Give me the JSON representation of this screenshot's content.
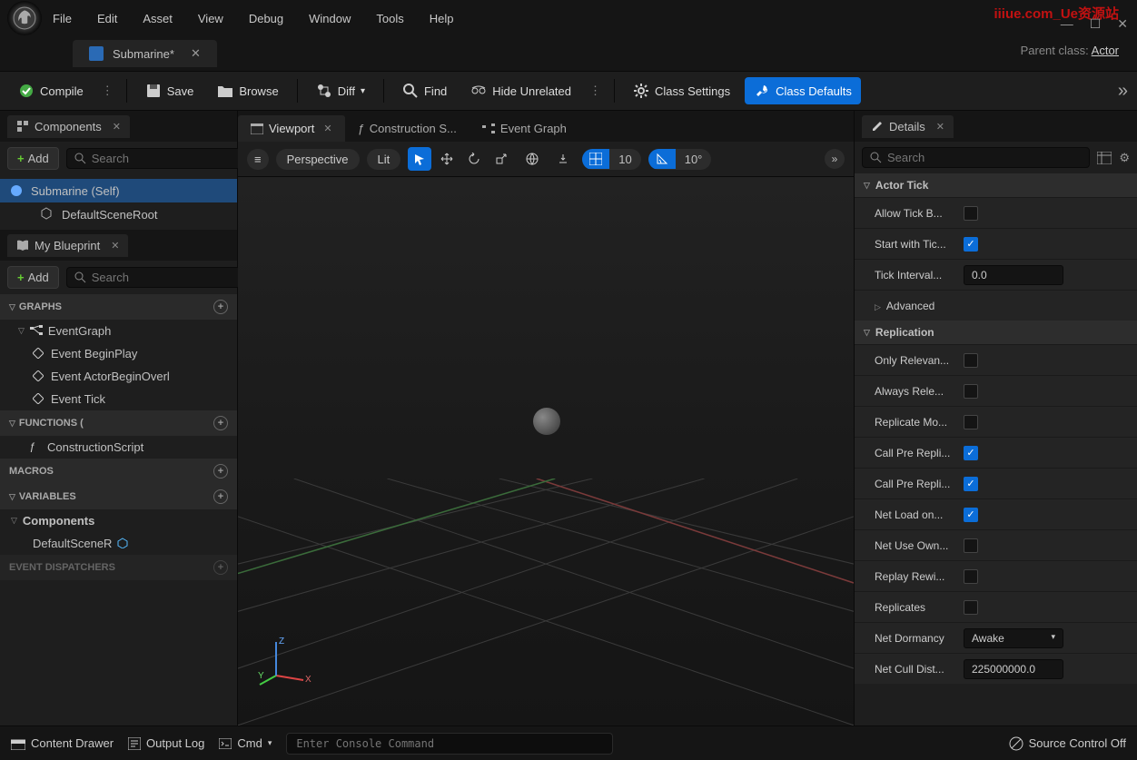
{
  "menu": [
    "File",
    "Edit",
    "Asset",
    "View",
    "Debug",
    "Window",
    "Tools",
    "Help"
  ],
  "watermark": "iiiue.com_Ue资源站",
  "docTab": {
    "title": "Submarine*"
  },
  "parentClass": {
    "label": "Parent class:",
    "value": "Actor"
  },
  "toolbar": {
    "compile": "Compile",
    "save": "Save",
    "browse": "Browse",
    "diff": "Diff",
    "find": "Find",
    "hide": "Hide Unrelated",
    "classSettings": "Class Settings",
    "classDefaults": "Class Defaults"
  },
  "componentsPanel": {
    "title": "Components",
    "add": "Add",
    "searchPlaceholder": "Search",
    "items": [
      {
        "label": "Submarine (Self)"
      },
      {
        "label": "DefaultSceneRoot"
      }
    ]
  },
  "myBlueprint": {
    "title": "My Blueprint",
    "add": "Add",
    "searchPlaceholder": "Search",
    "sections": {
      "graphs": {
        "title": "GRAPHS",
        "eventGraph": "EventGraph",
        "events": [
          "Event BeginPlay",
          "Event ActorBeginOverl",
          "Event Tick"
        ]
      },
      "functions": {
        "title": "FUNCTIONS (",
        "items": [
          "ConstructionScript"
        ]
      },
      "macros": {
        "title": "MACROS"
      },
      "variables": {
        "title": "VARIABLES",
        "sub": "Components",
        "items": [
          "DefaultSceneR"
        ]
      },
      "dispatchers": {
        "title": "EVENT DISPATCHERS"
      }
    }
  },
  "centerTabs": [
    {
      "label": "Viewport",
      "active": true,
      "close": true
    },
    {
      "label": "Construction S...",
      "active": false,
      "icon": "f"
    },
    {
      "label": "Event Graph",
      "active": false,
      "icon": "eg"
    }
  ],
  "viewportToolbar": {
    "perspective": "Perspective",
    "lit": "Lit",
    "snap": "10",
    "angle": "10°"
  },
  "gizmo": {
    "x": "X",
    "y": "Y",
    "z": "Z"
  },
  "detailsPanel": {
    "title": "Details",
    "searchPlaceholder": "Search",
    "sections": [
      {
        "title": "Actor Tick",
        "expanded": true,
        "rows": [
          {
            "label": "Allow Tick B...",
            "type": "check",
            "value": false
          },
          {
            "label": "Start with Tic...",
            "type": "check",
            "value": true
          },
          {
            "label": "Tick Interval...",
            "type": "num",
            "value": "0.0"
          }
        ],
        "advanced": "Advanced"
      },
      {
        "title": "Replication",
        "expanded": true,
        "rows": [
          {
            "label": "Only Relevan...",
            "type": "check",
            "value": false
          },
          {
            "label": "Always Rele...",
            "type": "check",
            "value": false
          },
          {
            "label": "Replicate Mo...",
            "type": "check",
            "value": false
          },
          {
            "label": "Call Pre Repli...",
            "type": "check",
            "value": true
          },
          {
            "label": "Call Pre Repli...",
            "type": "check",
            "value": true
          },
          {
            "label": "Net Load on...",
            "type": "check",
            "value": true
          },
          {
            "label": "Net Use Own...",
            "type": "check",
            "value": false
          },
          {
            "label": "Replay Rewi...",
            "type": "check",
            "value": false
          },
          {
            "label": "Replicates",
            "type": "check",
            "value": false
          },
          {
            "label": "Net Dormancy",
            "type": "drop",
            "value": "Awake"
          },
          {
            "label": "Net Cull Dist...",
            "type": "num",
            "value": "225000000.0"
          }
        ]
      }
    ]
  },
  "statusbar": {
    "contentDrawer": "Content Drawer",
    "outputLog": "Output Log",
    "cmd": "Cmd",
    "cmdPlaceholder": "Enter Console Command",
    "sourceControl": "Source Control Off"
  }
}
